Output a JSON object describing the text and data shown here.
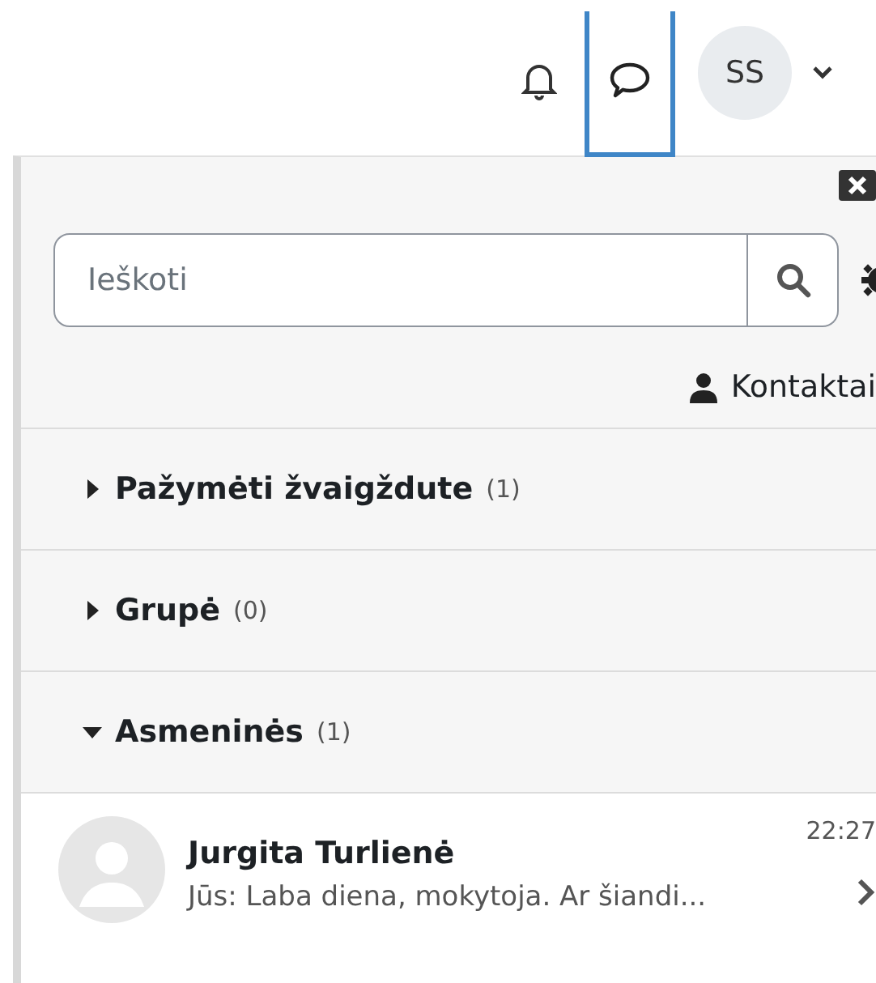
{
  "navbar": {
    "icons": [
      {
        "kind": "bell",
        "selected": false
      },
      {
        "kind": "chat",
        "selected": true
      }
    ],
    "avatar": "SS"
  },
  "drawer": {
    "search": {
      "placeholder": "Ieškoti"
    },
    "contacts_link": "Kontaktai",
    "sections": [
      {
        "title": "Pažymėti žvaigždute",
        "count": "(1)",
        "expanded": false
      },
      {
        "title": "Grupė",
        "count": "(0)",
        "expanded": false
      },
      {
        "title": "Asmeninės",
        "count": "(1)",
        "expanded": true
      }
    ],
    "conversations": [
      {
        "name": "Jurgita Turlienė",
        "time": "22:27",
        "preview": "Jūs: Laba diena, mokytoja. Ar šiandi..."
      }
    ]
  }
}
